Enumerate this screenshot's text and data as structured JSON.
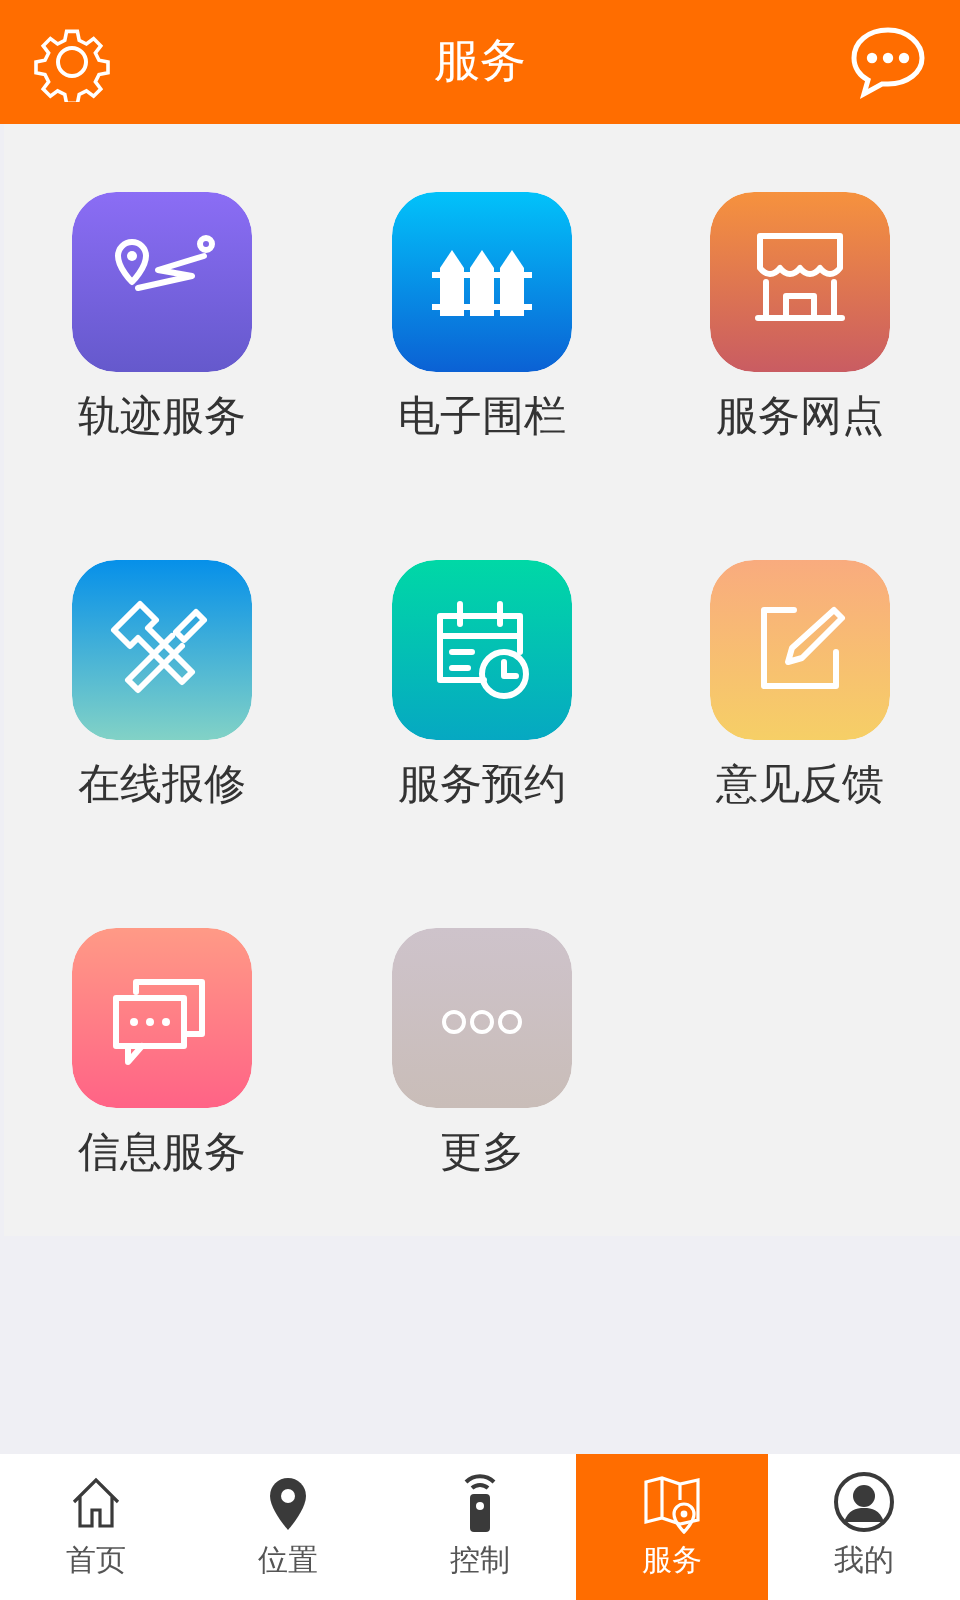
{
  "header": {
    "title": "服务"
  },
  "services": [
    {
      "label": "轨迹服务"
    },
    {
      "label": "电子围栏"
    },
    {
      "label": "服务网点"
    },
    {
      "label": "在线报修"
    },
    {
      "label": "服务预约"
    },
    {
      "label": "意见反馈"
    },
    {
      "label": "信息服务"
    },
    {
      "label": "更多"
    }
  ],
  "tab_bar": [
    {
      "label": "首页",
      "selected": false
    },
    {
      "label": "位置",
      "selected": false
    },
    {
      "label": "控制",
      "selected": false
    },
    {
      "label": "服务",
      "selected": true
    },
    {
      "label": "我的",
      "selected": false
    }
  ]
}
